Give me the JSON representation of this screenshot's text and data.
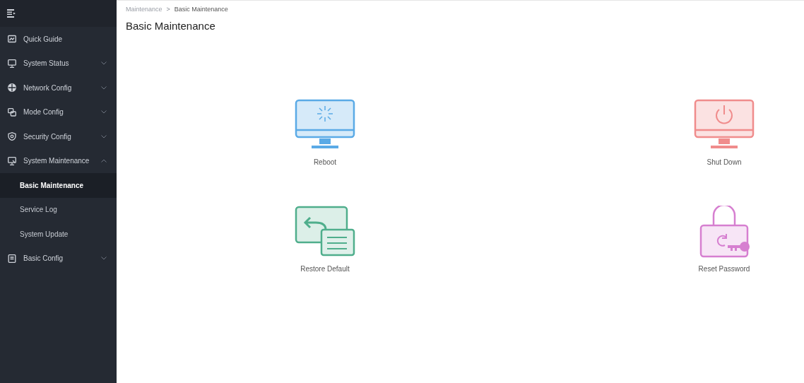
{
  "sidebar": {
    "items": [
      {
        "label": "Quick Guide",
        "kind": "guide"
      },
      {
        "label": "System Status",
        "kind": "monitor",
        "expanded": false
      },
      {
        "label": "Network Config",
        "kind": "globe",
        "expanded": false
      },
      {
        "label": "Mode Config",
        "kind": "mode",
        "expanded": false
      },
      {
        "label": "Security Config",
        "kind": "shield",
        "expanded": false
      },
      {
        "label": "System Maintenance",
        "kind": "maintenance",
        "expanded": true,
        "children": [
          {
            "label": "Basic Maintenance",
            "selected": true
          },
          {
            "label": "Service Log",
            "selected": false
          },
          {
            "label": "System Update",
            "selected": false
          }
        ]
      },
      {
        "label": "Basic Config",
        "kind": "doc",
        "expanded": false
      }
    ]
  },
  "breadcrumb": {
    "items": [
      "Maintenance",
      "Basic Maintenance"
    ],
    "separator": ">"
  },
  "title": "Basic Maintenance",
  "actions": [
    {
      "label": "Reboot",
      "kind": "reboot",
      "color": "#5aaae6"
    },
    {
      "label": "Shut Down",
      "kind": "shutdown",
      "color": "#f08c8c"
    },
    {
      "label": "Restore Default",
      "kind": "restore",
      "color": "#4fae8c"
    },
    {
      "label": "Reset Password",
      "kind": "reset",
      "color": "#d67fd0"
    }
  ]
}
